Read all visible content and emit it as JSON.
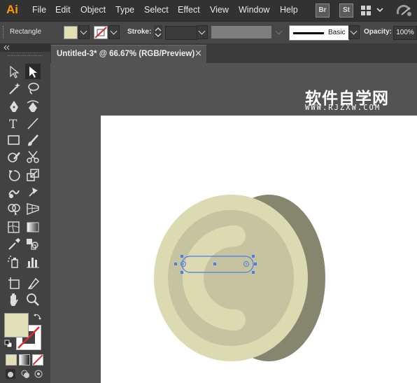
{
  "app": {
    "logo": "Ai"
  },
  "menu": [
    "File",
    "Edit",
    "Object",
    "Type",
    "Select",
    "Effect",
    "View",
    "Window",
    "Help"
  ],
  "menubar_right": {
    "bridge": "Br",
    "stock": "St"
  },
  "control_bar": {
    "selection_label": "Rectangle",
    "stroke_label": "Stroke:",
    "brush_label": "Basic",
    "opacity_label": "Opacity:",
    "opacity_value": "100%"
  },
  "document": {
    "tab_title": "Untitled-3* @ 66.67% (RGB/Preview)",
    "close_glyph": "×"
  },
  "watermark": {
    "chinese": "软件自学网",
    "url": "WWW.RJZXW.COM"
  },
  "colors": {
    "fill": "#e0dfb5",
    "coin_face": "#dcdab0",
    "coin_inner": "#c6c4a0",
    "coin_side": "#86866e",
    "selection": "#4a7cf0"
  },
  "icons": [
    "selection-tool-icon",
    "direct-selection-tool-icon",
    "magic-wand-icon",
    "lasso-icon",
    "pen-icon",
    "curvature-icon",
    "type-icon",
    "line-icon",
    "rectangle-icon",
    "paintbrush-icon",
    "shaper-icon",
    "scissors-icon",
    "rotate-icon",
    "scale-icon",
    "warp-icon",
    "free-transform-icon",
    "shape-builder-icon",
    "perspective-grid-icon",
    "mesh-icon",
    "gradient-icon",
    "eyedropper-icon",
    "blend-icon",
    "symbol-sprayer-icon",
    "column-graph-icon",
    "artboard-icon",
    "slice-icon",
    "hand-icon",
    "zoom-icon"
  ]
}
